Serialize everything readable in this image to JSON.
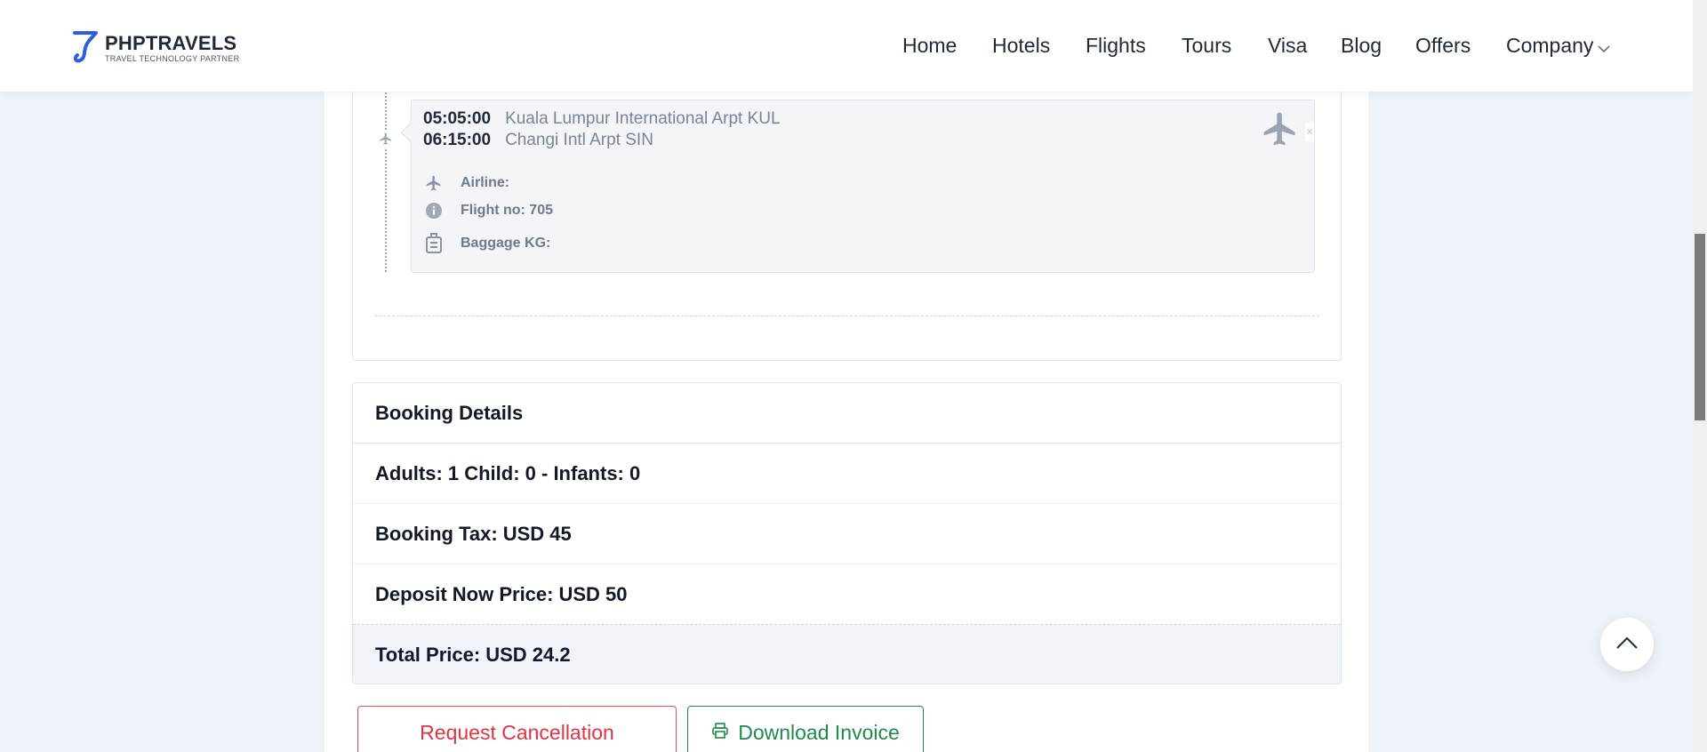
{
  "header": {
    "logo_name": "PHPTRAVELS",
    "logo_tagline": "TRAVEL TECHNOLOGY PARTNER",
    "nav": [
      "Home",
      "Hotels",
      "Flights",
      "Tours",
      "Visa",
      "Blog",
      "Offers",
      "Company"
    ]
  },
  "flight_segment": {
    "departure_time": "05:05:00",
    "departure_airport": "Kuala Lumpur International Arpt KUL",
    "arrival_time": "06:15:00",
    "arrival_airport": "Changi Intl Arpt SIN",
    "airline_label": "Airline:",
    "flight_no_label": "Flight no: 705",
    "baggage_label": "Baggage KG:"
  },
  "booking": {
    "title": "Booking Details",
    "passengers": "Adults: 1 Child: 0 - Infants: 0",
    "tax_label": "Booking Tax:",
    "tax_value": "USD 45",
    "deposit_label": "Deposit Now Price:",
    "deposit_value": "USD 50",
    "total_label": "Total Price:",
    "total_value": "USD 24.2"
  },
  "actions": {
    "cancel_label": "Request Cancellation",
    "invoice_label": "Download Invoice"
  },
  "colors": {
    "cancel": "#dc3545",
    "invoice": "#1f8a4c",
    "page_bg": "#eef3f9"
  }
}
